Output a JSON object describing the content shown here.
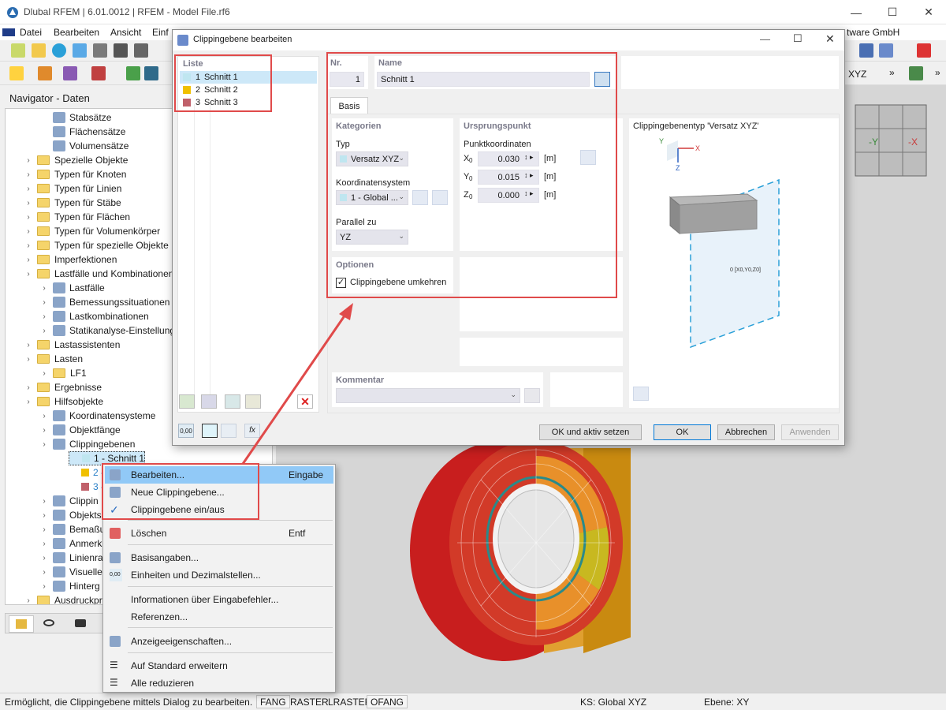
{
  "window": {
    "title": "Dlubal RFEM | 6.01.0012 | RFEM - Model File.rf6",
    "company_partial": "tware GmbH"
  },
  "menu": [
    "Datei",
    "Bearbeiten",
    "Ansicht",
    "Einf"
  ],
  "toolbar": {
    "coord_system": "XYZ"
  },
  "navigator": {
    "title": "Navigator - Daten",
    "items": [
      {
        "label": "Stabsätze",
        "level": 2
      },
      {
        "label": "Flächensätze",
        "level": 2
      },
      {
        "label": "Volumensätze",
        "level": 2
      },
      {
        "label": "Spezielle Objekte",
        "level": 1
      },
      {
        "label": "Typen für Knoten",
        "level": 1
      },
      {
        "label": "Typen für Linien",
        "level": 1
      },
      {
        "label": "Typen für Stäbe",
        "level": 1
      },
      {
        "label": "Typen für Flächen",
        "level": 1
      },
      {
        "label": "Typen für Volumenkörper",
        "level": 1
      },
      {
        "label": "Typen für spezielle Objekte",
        "level": 1
      },
      {
        "label": "Imperfektionen",
        "level": 1
      },
      {
        "label": "Lastfälle und Kombinationen",
        "level": 1
      },
      {
        "label": "Lastfälle",
        "level": 2
      },
      {
        "label": "Bemessungssituationen",
        "level": 2
      },
      {
        "label": "Lastkombinationen",
        "level": 2
      },
      {
        "label": "Statikanalyse-Einstellungen",
        "level": 2
      },
      {
        "label": "Lastassistenten",
        "level": 1
      },
      {
        "label": "Lasten",
        "level": 1
      },
      {
        "label": "LF1",
        "level": 2
      },
      {
        "label": "Ergebnisse",
        "level": 1
      },
      {
        "label": "Hilfsobjekte",
        "level": 1
      },
      {
        "label": "Koordinatensysteme",
        "level": 2
      },
      {
        "label": "Objektfänge",
        "level": 2
      },
      {
        "label": "Clippingebenen",
        "level": 2
      },
      {
        "label": "1 - Schnitt 1",
        "level": 3
      },
      {
        "label": "2 - S",
        "level": 3
      },
      {
        "label": "3 - S",
        "level": 3
      },
      {
        "label": "Clippin",
        "level": 2
      },
      {
        "label": "Objekts",
        "level": 2
      },
      {
        "label": "Bemaßu",
        "level": 2
      },
      {
        "label": "Anmerk",
        "level": 2
      },
      {
        "label": "Linienra",
        "level": 2
      },
      {
        "label": "Visuelle",
        "level": 2
      },
      {
        "label": "Hinterg",
        "level": 2
      },
      {
        "label": "Ausdruckpr",
        "level": 1
      }
    ]
  },
  "dialog": {
    "title": "Clippingebene bearbeiten",
    "list_header": "Liste",
    "list": [
      {
        "num": "1",
        "name": "Schnitt 1",
        "color": "#bfe6f0"
      },
      {
        "num": "2",
        "name": "Schnitt 2",
        "color": "#f0c000"
      },
      {
        "num": "3",
        "name": "Schnitt 3",
        "color": "#c0606a"
      }
    ],
    "nr_label": "Nr.",
    "nr_value": "1",
    "name_label": "Name",
    "name_value": "Schnitt 1",
    "tab_basis": "Basis",
    "kategorien": "Kategorien",
    "typ_label": "Typ",
    "typ_value": "Versatz XYZ",
    "ks_label": "Koordinatensystem",
    "ks_value": "1 - Global ...",
    "parallel_label": "Parallel zu",
    "parallel_value": "YZ",
    "ursprung": "Ursprungspunkt",
    "punktkoord": "Punktkoordinaten",
    "coords": [
      {
        "axis": "X",
        "sub": "0",
        "value": "0.030",
        "unit": "[m]"
      },
      {
        "axis": "Y",
        "sub": "0",
        "value": "0.015",
        "unit": "[m]"
      },
      {
        "axis": "Z",
        "sub": "0",
        "value": "0.000",
        "unit": "[m]"
      }
    ],
    "optionen": "Optionen",
    "umkehren_label": "Clippingebene umkehren",
    "umkehren_checked": true,
    "kommentar": "Kommentar",
    "preview_title": "Clippingebenentyp 'Versatz XYZ'",
    "preview_point_label": "0 [X0,Y0,Z0]",
    "axis_y": "Y",
    "axis_x": "X",
    "axis_z": "Z",
    "btn_ok_aktiv": "OK und aktiv setzen",
    "btn_ok": "OK",
    "btn_abbrechen": "Abbrechen",
    "btn_anwenden": "Anwenden"
  },
  "context_menu": [
    {
      "label": "Bearbeiten...",
      "key": "Eingabe",
      "highlighted": true,
      "icon": "edit-icon"
    },
    {
      "label": "Neue Clippingebene...",
      "key": "",
      "icon": "new-clipping-icon"
    },
    {
      "label": "Clippingebene ein/aus",
      "key": "",
      "icon": "check-icon"
    },
    {
      "label": "Löschen",
      "key": "Entf",
      "icon": "delete-icon"
    },
    {
      "label": "Basisangaben...",
      "key": "",
      "icon": "base-data-icon"
    },
    {
      "label": "Einheiten und Dezimalstellen...",
      "key": "",
      "icon": "units-icon"
    },
    {
      "label": "Informationen über Eingabefehler...",
      "key": ""
    },
    {
      "label": "Referenzen...",
      "key": ""
    },
    {
      "label": "Anzeigeeigenschaften...",
      "key": "",
      "icon": "display-props-icon"
    },
    {
      "label": "Auf Standard erweitern",
      "key": "",
      "icon": "expand-icon"
    },
    {
      "label": "Alle reduzieren",
      "key": "",
      "icon": "collapse-icon"
    }
  ],
  "viewcube": {
    "neg_y": "-Y",
    "neg_x": "-X"
  },
  "status": {
    "message": "Ermöglicht, die Clippingebene mittels Dialog zu bearbeiten.",
    "toggles": [
      "FANG",
      "RASTER",
      "LRASTER",
      "OFANG"
    ],
    "ks": "KS: Global XYZ",
    "ebene": "Ebene: XY"
  },
  "units_icon_text": "0,00",
  "fx_text": "fx"
}
